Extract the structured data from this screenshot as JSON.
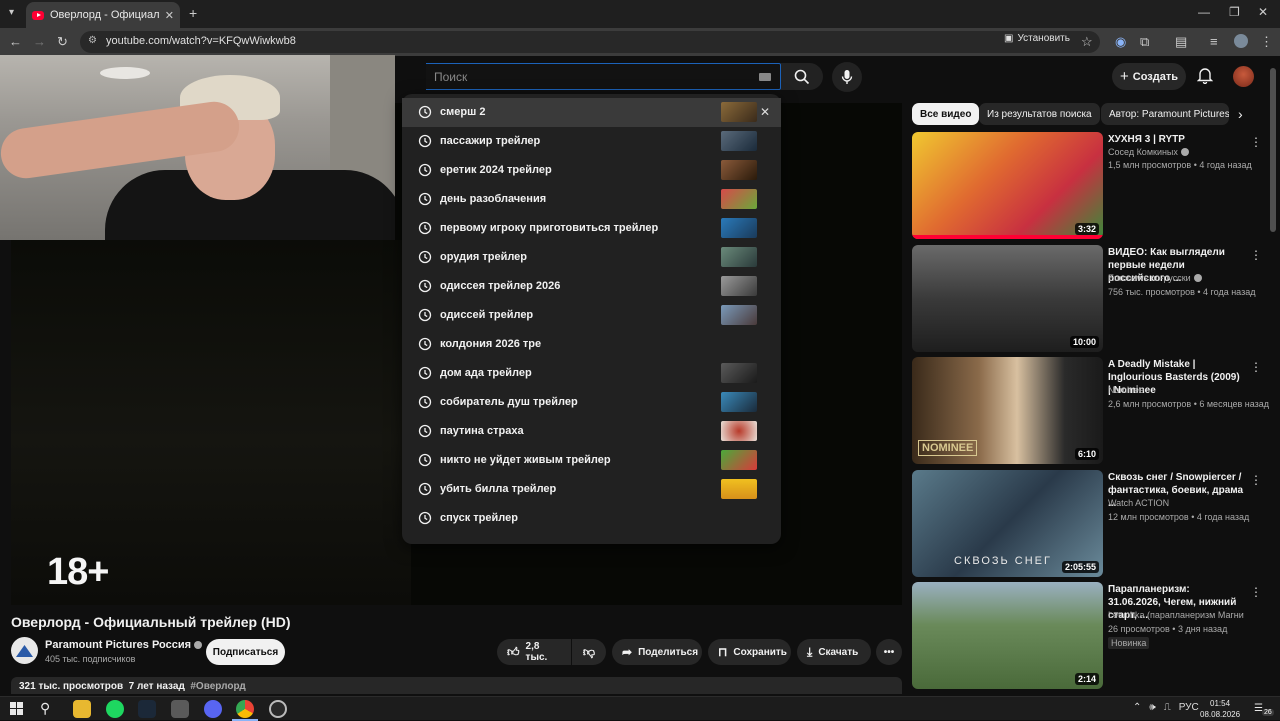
{
  "browser": {
    "tab_title": "Оверлорд - Официальный трейлер",
    "url": "youtube.com/watch?v=KFQwWiwkwb8",
    "install_label": "Установить"
  },
  "header": {
    "search_placeholder": "Поиск",
    "create_label": "Создать"
  },
  "suggestions": [
    {
      "text": "смерш 2",
      "thumb": "#6b5a3a"
    },
    {
      "text": "пассажир трейлер",
      "thumb": "#3a4a5a"
    },
    {
      "text": "еретик 2024 трейлер",
      "thumb": "#5a3a2a"
    },
    {
      "text": "день разоблачения",
      "thumb": "#b83a3a"
    },
    {
      "text": "первому игроку приготовиться трейлер",
      "thumb": "#2a6a9a"
    },
    {
      "text": "орудия трейлер",
      "thumb": "#4a6a5a"
    },
    {
      "text": "одиссея трейлер 2026",
      "thumb": "#7a7a7a"
    },
    {
      "text": "одиссей трейлер",
      "thumb": "#5a7a9a"
    },
    {
      "text": "колдония 2026 тре",
      "thumb": ""
    },
    {
      "text": "дом ада трейлер",
      "thumb": "#3a3a3a"
    },
    {
      "text": "собиратель душ трейлер",
      "thumb": "#2a5a7a"
    },
    {
      "text": "паутина страха",
      "thumb": "#c0b8b0"
    },
    {
      "text": "никто не уйдет живым трейлер",
      "thumb": "#4a8a3a"
    },
    {
      "text": "убить билла трейлер",
      "thumb": "#e8b020"
    },
    {
      "text": "спуск трейлер",
      "thumb": ""
    }
  ],
  "video": {
    "rating": "18+",
    "title": "Оверлорд - Официальный трейлер (HD)",
    "channel": "Paramount Pictures Россия",
    "subscribers": "405 тыс. подписчиков",
    "subscribe_label": "Подписаться",
    "likes": "2,8 тыс.",
    "share_label": "Поделиться",
    "save_label": "Сохранить",
    "download_label": "Скачать",
    "views": "321 тыс. просмотров",
    "age": "7 лет назад",
    "hashtag": "#Оверлорд"
  },
  "chips": [
    "Все видео",
    "Из результатов поиска",
    "Автор: Paramount Pictures"
  ],
  "recommendations": [
    {
      "title": "ХУХНЯ 3 | RYTP",
      "channel": "Сосед Комкиных",
      "meta": "1,5 млн просмотров • 4 года назад",
      "duration": "3:32",
      "colors": [
        "#e8c020",
        "#c83030"
      ]
    },
    {
      "title": "ВИДЕО: Как выглядели первые недели российского ...",
      "channel": "Euronews по-русски",
      "meta": "756 тыс. просмотров • 4 года назад",
      "duration": "10:00",
      "colors": [
        "#5a5a5a",
        "#2a2a2a"
      ]
    },
    {
      "title": "A Deadly Mistake | Inglourious Basterds (2009) | Nominee",
      "channel": "Nominee",
      "meta": "2,6 млн просмотров • 6 месяцев назад",
      "duration": "6:10",
      "colors": [
        "#6a4a2a",
        "#1a1a1a"
      ]
    },
    {
      "title": "Сквозь снег / Snowpiercer / фантастика, боевик, драма ...",
      "channel": "Watch ACTION",
      "meta": "12 млн просмотров • 4 года назад",
      "duration": "2:05:55",
      "colors": [
        "#4a6a7a",
        "#1a2a3a"
      ]
    },
    {
      "title": "Парапланеризм: 31.06.2026, Чегем, нижний старт, ...",
      "channel": "Letuchka (парапланеризм Магнитогор...",
      "meta": "26 просмотров • 3 дня назад",
      "duration": "2:14",
      "colors": [
        "#7a9a5a",
        "#3a5a2a"
      ],
      "badge": "Новинка"
    }
  ],
  "thumb_text": {
    "nominee": "NOMINEE",
    "snow": "СКВОЗЬ СНЕГ"
  },
  "taskbar": {
    "lang": "РУС",
    "time": "01:54",
    "date": "08.08.2026",
    "notif_count": "26"
  }
}
